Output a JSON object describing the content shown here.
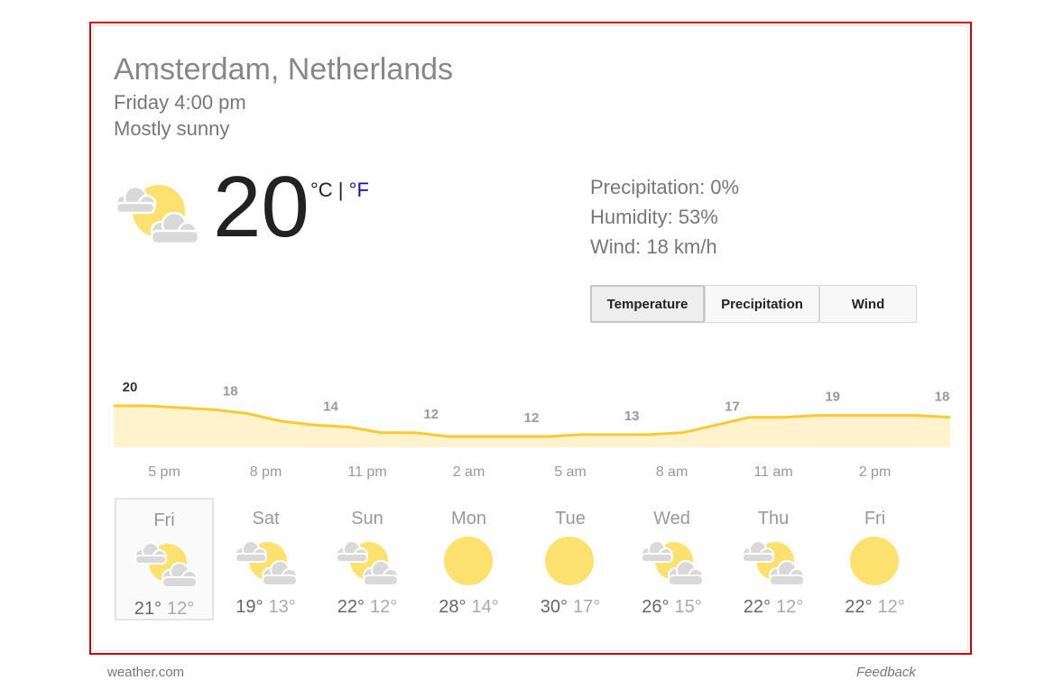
{
  "location": "Amsterdam, Netherlands",
  "datetime": "Friday 4:00 pm",
  "condition": "Mostly sunny",
  "current": {
    "temperature": "20",
    "unit_c": "°C",
    "unit_sep": " | ",
    "unit_f": "°F",
    "icon": "partly-sunny-icon"
  },
  "details": {
    "precipitation": "Precipitation: 0%",
    "humidity": "Humidity: 53%",
    "wind": "Wind: 18 km/h"
  },
  "tabs": {
    "temperature": "Temperature",
    "precipitation": "Precipitation",
    "wind": "Wind",
    "active": "temperature"
  },
  "hours": [
    "5 pm",
    "8 pm",
    "11 pm",
    "2 am",
    "5 am",
    "8 am",
    "11 am",
    "2 pm"
  ],
  "chart_data": {
    "type": "area",
    "x": [
      "4 pm",
      "5 pm",
      "6 pm",
      "7 pm",
      "8 pm",
      "9 pm",
      "10 pm",
      "11 pm",
      "12 am",
      "1 am",
      "2 am",
      "3 am",
      "4 am",
      "5 am",
      "6 am",
      "7 am",
      "8 am",
      "9 am",
      "10 am",
      "11 am",
      "12 pm",
      "1 pm",
      "2 pm",
      "3 pm",
      "4 pm",
      "5 pm"
    ],
    "values": [
      20,
      20,
      19.5,
      19,
      18,
      16,
      15,
      14.5,
      13,
      13,
      12,
      12,
      12,
      12,
      12.5,
      12.5,
      12.5,
      13,
      15,
      17,
      17,
      17.5,
      17.5,
      17.5,
      17.5,
      17
    ],
    "labels": [
      {
        "x_index": 0,
        "text": "20"
      },
      {
        "x_index": 3,
        "text": "18"
      },
      {
        "x_index": 6,
        "text": "14"
      },
      {
        "x_index": 9,
        "text": "12"
      },
      {
        "x_index": 12,
        "text": "12"
      },
      {
        "x_index": 15,
        "text": "13"
      },
      {
        "x_index": 18,
        "text": "17"
      },
      {
        "x_index": 21,
        "text": "19"
      },
      {
        "x_index": 24,
        "text": "18"
      }
    ],
    "line_color": "#fcc934",
    "fill_color": "#fef3cc"
  },
  "days": [
    {
      "name": "Fri",
      "hi": "21°",
      "lo": "12°",
      "icon": "partly-sunny-icon",
      "selected": true
    },
    {
      "name": "Sat",
      "hi": "19°",
      "lo": "13°",
      "icon": "partly-sunny-icon",
      "selected": false
    },
    {
      "name": "Sun",
      "hi": "22°",
      "lo": "12°",
      "icon": "partly-sunny-icon",
      "selected": false
    },
    {
      "name": "Mon",
      "hi": "28°",
      "lo": "14°",
      "icon": "sunny-icon",
      "selected": false
    },
    {
      "name": "Tue",
      "hi": "30°",
      "lo": "17°",
      "icon": "sunny-icon",
      "selected": false
    },
    {
      "name": "Wed",
      "hi": "26°",
      "lo": "15°",
      "icon": "partly-sunny-icon",
      "selected": false
    },
    {
      "name": "Thu",
      "hi": "22°",
      "lo": "12°",
      "icon": "partly-sunny-icon",
      "selected": false
    },
    {
      "name": "Fri",
      "hi": "22°",
      "lo": "12°",
      "icon": "sunny-icon",
      "selected": false
    }
  ],
  "footer": {
    "source": "weather.com",
    "feedback": "Feedback"
  },
  "colors": {
    "sun": "#fde16e",
    "cloud": "#d9d9d9",
    "highlight": "#d50000",
    "link": "#1a0dab"
  }
}
